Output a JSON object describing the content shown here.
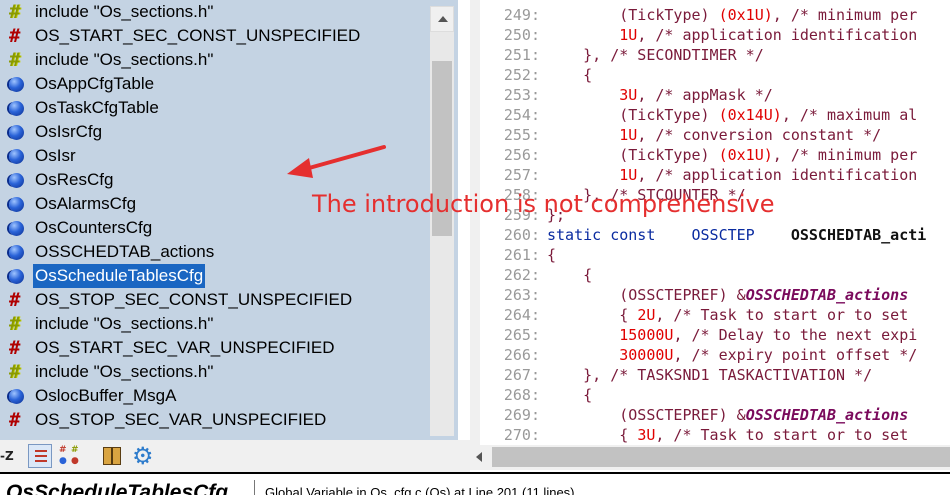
{
  "symbols": [
    {
      "label": "include \"Os_sections.h\"",
      "icon": "hash-green-icon",
      "kind": "hash-g"
    },
    {
      "label": "OS_START_SEC_CONST_UNSPECIFIED",
      "icon": "hash-red-icon",
      "kind": "hash-r"
    },
    {
      "label": "include \"Os_sections.h\"",
      "icon": "hash-green-icon",
      "kind": "hash-g"
    },
    {
      "label": "OsAppCfgTable",
      "icon": "blue-ball-icon",
      "kind": "ball"
    },
    {
      "label": "OsTaskCfgTable",
      "icon": "blue-ball-icon",
      "kind": "ball"
    },
    {
      "label": "OsIsrCfg",
      "icon": "blue-ball-icon",
      "kind": "ball"
    },
    {
      "label": "OsIsr",
      "icon": "blue-ball-icon",
      "kind": "ball"
    },
    {
      "label": "OsResCfg",
      "icon": "blue-ball-icon",
      "kind": "ball"
    },
    {
      "label": "OsAlarmsCfg",
      "icon": "blue-ball-icon",
      "kind": "ball"
    },
    {
      "label": "OsCountersCfg",
      "icon": "blue-ball-icon",
      "kind": "ball"
    },
    {
      "label": "OSSCHEDTAB_actions",
      "icon": "blue-ball-icon",
      "kind": "ball"
    },
    {
      "label": "OsScheduleTablesCfg",
      "icon": "blue-ball-icon",
      "kind": "ball",
      "selected": true
    },
    {
      "label": "OS_STOP_SEC_CONST_UNSPECIFIED",
      "icon": "hash-red-icon",
      "kind": "hash-r"
    },
    {
      "label": "include \"Os_sections.h\"",
      "icon": "hash-green-icon",
      "kind": "hash-g"
    },
    {
      "label": "OS_START_SEC_VAR_UNSPECIFIED",
      "icon": "hash-red-icon",
      "kind": "hash-r"
    },
    {
      "label": "include \"Os_sections.h\"",
      "icon": "hash-green-icon",
      "kind": "hash-g"
    },
    {
      "label": "OslocBuffer_MsgA",
      "icon": "blue-ball-icon",
      "kind": "ball"
    },
    {
      "label": "OS_STOP_SEC_VAR_UNSPECIFIED",
      "icon": "hash-red-icon",
      "kind": "hash-r"
    }
  ],
  "toolbar": {
    "az_label": "-Z",
    "list_icon": "list-view-icon",
    "grid_icon": "symbol-types-icon",
    "book_icon": "book-icon",
    "gear_icon": "gear-icon"
  },
  "code_lines": [
    {
      "num": "249:",
      "segs": [
        [
          "        ",
          ""
        ],
        [
          "(TickType) ",
          ""
        ],
        [
          "(0x1U)",
          "red"
        ],
        [
          ", /* minimum per",
          ""
        ]
      ]
    },
    {
      "num": "250:",
      "segs": [
        [
          "        ",
          ""
        ],
        [
          "1U",
          "red"
        ],
        [
          ", /* application identification",
          ""
        ]
      ]
    },
    {
      "num": "251:",
      "segs": [
        [
          "    }, /* SECONDTIMER */",
          ""
        ]
      ]
    },
    {
      "num": "252:",
      "segs": [
        [
          "    {",
          ""
        ]
      ]
    },
    {
      "num": "253:",
      "segs": [
        [
          "        ",
          ""
        ],
        [
          "3U",
          "red"
        ],
        [
          ", /* appMask */",
          ""
        ]
      ]
    },
    {
      "num": "254:",
      "segs": [
        [
          "        ",
          ""
        ],
        [
          "(TickType) ",
          ""
        ],
        [
          "(0x14U)",
          "red"
        ],
        [
          ", /* maximum al",
          ""
        ]
      ]
    },
    {
      "num": "255:",
      "segs": [
        [
          "        ",
          ""
        ],
        [
          "1U",
          "red"
        ],
        [
          ", /* conversion constant */",
          ""
        ]
      ]
    },
    {
      "num": "256:",
      "segs": [
        [
          "        ",
          ""
        ],
        [
          "(TickType) ",
          ""
        ],
        [
          "(0x1U)",
          "red"
        ],
        [
          ", /* minimum per",
          ""
        ]
      ]
    },
    {
      "num": "257:",
      "segs": [
        [
          "        ",
          ""
        ],
        [
          "1U",
          "red"
        ],
        [
          ", /* application identification",
          ""
        ]
      ]
    },
    {
      "num": "258:",
      "segs": [
        [
          "    }, /* STCOUNTER */",
          ""
        ]
      ]
    },
    {
      "num": "259:",
      "segs": [
        [
          "};",
          ""
        ]
      ]
    },
    {
      "num": "260:",
      "segs": [
        [
          "static const",
          "kw"
        ],
        [
          "    ",
          ""
        ],
        [
          "OSSCTEP",
          "kw"
        ],
        [
          "    ",
          ""
        ],
        [
          "OSSCHEDTAB_acti",
          "bold"
        ]
      ]
    },
    {
      "num": "261:",
      "segs": [
        [
          "{",
          ""
        ]
      ]
    },
    {
      "num": "262:",
      "segs": [
        [
          "    {",
          ""
        ]
      ]
    },
    {
      "num": "263:",
      "segs": [
        [
          "        (OSSCTEPREF) &",
          ""
        ],
        [
          "OSSCHEDTAB_actions",
          "bi"
        ]
      ]
    },
    {
      "num": "264:",
      "segs": [
        [
          "        { ",
          ""
        ],
        [
          "2U",
          "red"
        ],
        [
          ", /* Task to start or to set",
          ""
        ]
      ]
    },
    {
      "num": "265:",
      "segs": [
        [
          "        ",
          ""
        ],
        [
          "15000U",
          "red"
        ],
        [
          ", /* Delay to the next expi",
          ""
        ]
      ]
    },
    {
      "num": "266:",
      "segs": [
        [
          "        ",
          ""
        ],
        [
          "30000U",
          "red"
        ],
        [
          ", /* expiry point offset */",
          ""
        ]
      ]
    },
    {
      "num": "267:",
      "segs": [
        [
          "    }, /* TASKSND1 TASKACTIVATION */",
          ""
        ]
      ]
    },
    {
      "num": "268:",
      "segs": [
        [
          "    {",
          ""
        ]
      ]
    },
    {
      "num": "269:",
      "segs": [
        [
          "        (OSSCTEPREF) &",
          ""
        ],
        [
          "OSSCHEDTAB_actions",
          "bi"
        ]
      ]
    },
    {
      "num": "270:",
      "segs": [
        [
          "        { ",
          ""
        ],
        [
          "3U",
          "red"
        ],
        [
          ", /* Task to start or to set",
          ""
        ]
      ]
    }
  ],
  "status": {
    "title": "OsScheduleTablesCfg",
    "info": "Global Variable in Os_cfg.c (Os) at Line 201 (11 lines)"
  },
  "annotation": {
    "text": "The introduction is not comprehensive",
    "color": "#e52f2f"
  }
}
